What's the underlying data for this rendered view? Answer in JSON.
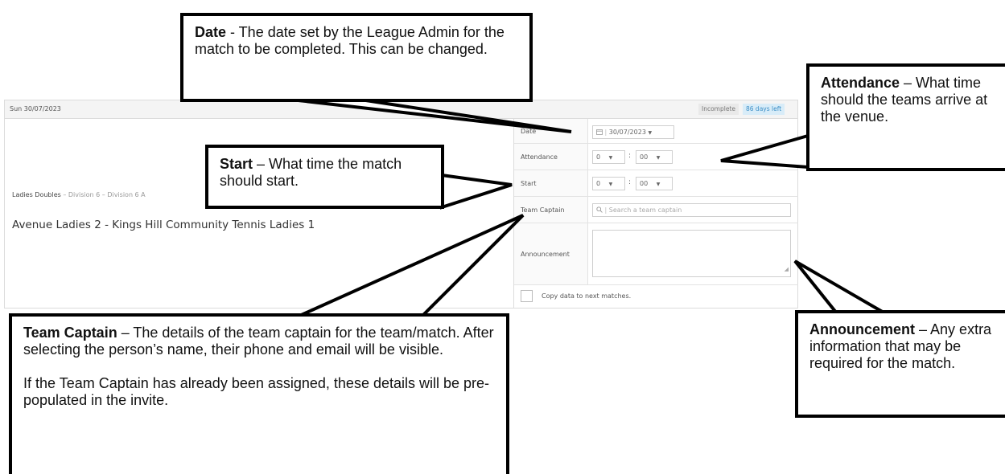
{
  "header": {
    "date": "Sun 30/07/2023",
    "status_badge": "Incomplete",
    "days_left_badge": "86 days left"
  },
  "match": {
    "competition": "Ladies Doubles",
    "division_path": " – Division 6 – Division 6 A",
    "title": "Avenue Ladies 2 - Kings Hill Community Tennis Ladies 1"
  },
  "form": {
    "date": {
      "label": "Date",
      "value": "30/07/2023",
      "icon": "calendar-icon"
    },
    "attendance": {
      "label": "Attendance",
      "hour": "0",
      "minute": "00"
    },
    "start": {
      "label": "Start",
      "hour": "0",
      "minute": "00"
    },
    "team_captain": {
      "label": "Team Captain",
      "placeholder": "Search a team captain",
      "icon": "search-icon"
    },
    "announcement": {
      "label": "Announcement",
      "value": ""
    },
    "copy_data": {
      "label": "Copy data to next matches.",
      "checked": false
    }
  },
  "callouts": {
    "date": {
      "title": "Date",
      "text": " - The date set by the League Admin for the match to be completed. This can be changed."
    },
    "attendance": {
      "title": "Attendance",
      "text": " – What time should the teams arrive at the venue."
    },
    "start": {
      "title": "Start",
      "text": " – What time the match should start."
    },
    "team_captain": {
      "title": "Team Captain",
      "text": " – The details of the team captain for the team/match. After selecting the person’s name, their phone and email will be visible.",
      "text2": "If the Team Captain has already been assigned, these details will be pre-populated in the invite."
    },
    "announcement": {
      "title": "Announcement",
      "text": " – Any extra information that may be required for the match."
    }
  }
}
